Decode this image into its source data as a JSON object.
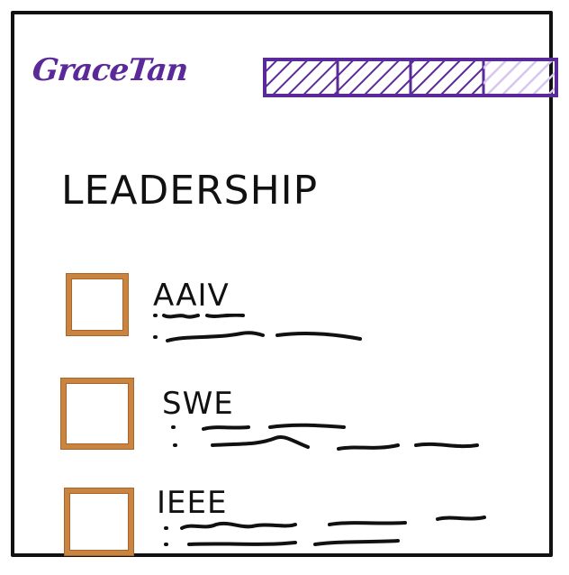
{
  "brand": {
    "logo_text": "GraceTan",
    "accent_color": "#5b2a9a"
  },
  "progress": {
    "total_segments": 4,
    "completed_segments": 3,
    "fraction": 0.75
  },
  "page": {
    "title": "LEADERSHIP"
  },
  "items": [
    {
      "label": "AAIV",
      "checked": false
    },
    {
      "label": "SWE",
      "checked": false
    },
    {
      "label": "IEEE",
      "checked": false
    }
  ],
  "colors": {
    "checkbox_border": "#c9853f",
    "ink": "#111111"
  }
}
